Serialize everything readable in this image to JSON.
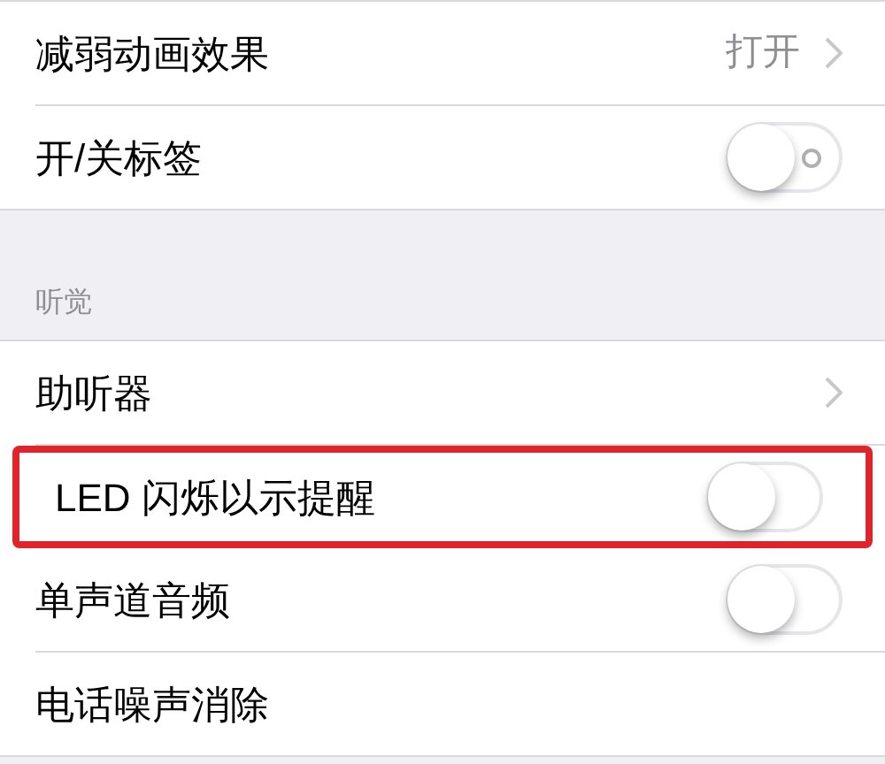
{
  "groups": [
    {
      "rows": [
        {
          "kind": "value",
          "label": "减弱动画效果",
          "value": "打开"
        },
        {
          "kind": "toggle",
          "label": "开/关标签",
          "on": false,
          "on_off_label": true
        }
      ]
    },
    {
      "header": "听觉",
      "rows": [
        {
          "kind": "chevron",
          "label": "助听器"
        },
        {
          "kind": "toggle",
          "label": "LED 闪烁以示提醒",
          "on": false,
          "highlighted": true
        },
        {
          "kind": "toggle",
          "label": "单声道音频",
          "on": false
        },
        {
          "kind": "plain",
          "label": "电话噪声消除"
        }
      ]
    }
  ]
}
